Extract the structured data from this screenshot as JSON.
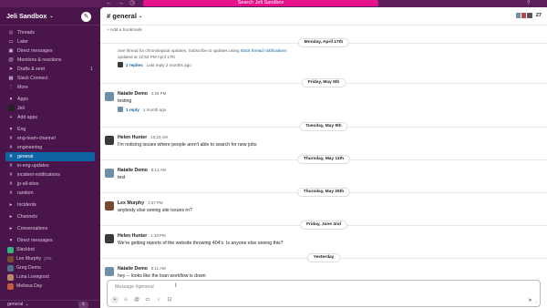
{
  "topbar": {
    "back": "←",
    "forward": "→",
    "history": "◷",
    "search_text": "Search Jeli Sandbox",
    "help": "?"
  },
  "sidebar": {
    "workspace": "Jeli Sandbox",
    "chevron": "⌄",
    "compose_icon": "✎",
    "nav": [
      {
        "icon": "◎",
        "label": "Threads"
      },
      {
        "icon": "▭",
        "label": "Later"
      },
      {
        "icon": "▣",
        "label": "Direct messages"
      },
      {
        "icon": "@",
        "label": "Mentions & reactions"
      },
      {
        "icon": "➤",
        "label": "Drafts & sent",
        "badge": "1"
      },
      {
        "icon": "▦",
        "label": "Slack Connect"
      },
      {
        "icon": "⋮",
        "label": "More"
      }
    ],
    "apps_header": "Apps",
    "apps": [
      {
        "label": "Jeli"
      },
      {
        "icon": "+",
        "label": "Add apps"
      }
    ],
    "eng_header": "Eng",
    "channels": [
      "eng-team-channel",
      "engineering",
      "general",
      "in-eng-updates",
      "incident-notifications",
      "jp-all-sites",
      "random"
    ],
    "collapsed_sections": [
      "Incidents",
      "Channels",
      "Conversations"
    ],
    "dm_header": "Direct messages",
    "dms": [
      {
        "label": "Slackbot",
        "color": "#2eb67d"
      },
      {
        "label": "Lex Murphy",
        "suffix": "you",
        "color": "#7a4a2e"
      },
      {
        "label": "Greg Demo",
        "color": "#4b6f8f"
      },
      {
        "label": "Luna Lovegood",
        "color": "#b98a6a"
      },
      {
        "label": "Melissa Day",
        "color": "#c15a3a"
      }
    ],
    "footer_label": "general",
    "footer_chev": "⌄",
    "footer_badge": "⇩"
  },
  "channel": {
    "name": "# general",
    "chev": "⌄",
    "member_count": "27",
    "bookmark": "+ Add a bookmark"
  },
  "feed": {
    "top_note_text": "See thread for chronological updates. Subscribe to updates using ",
    "top_note_link": "Slack thread notifications",
    "top_note_tail": "updated at 12:53 PM April 17th",
    "top_reply_count": "2 replies",
    "top_reply_last": "Last reply 2 months ago",
    "date_top": "Monday, April 17th",
    "messages": [
      {
        "date": "Friday, May 5th",
        "author": "Natalie Demo",
        "time": "4:26 PM",
        "text": "testing",
        "reply": "1 reply",
        "reply_last": "1 month ago",
        "color": "#6f8fa8"
      },
      {
        "date": "Tuesday, May 9th",
        "author": "Helen Hunter",
        "time": "10:23 AM",
        "text": "I'm noticing issues where people aren't able to search for new jobs",
        "color": "#3a3a3a"
      },
      {
        "date": "Thursday, May 11th",
        "author": "Natalie Demo",
        "time": "8:13 AM",
        "text": "test",
        "color": "#6f8fa8"
      },
      {
        "date": "Thursday, May 25th",
        "author": "Lex Murphy",
        "time": "1:37 PM",
        "text": "anybody else seeing site issues rn?",
        "color": "#7a4a2e"
      },
      {
        "date": "Friday, June 2nd",
        "author": "Helen Hunter",
        "time": "1:33 PM",
        "text": "We're getting reports of the website throwing 404's. Is anyone else seeing this?",
        "color": "#3a3a3a"
      },
      {
        "date": "Yesterday",
        "author": "Natalie Demo",
        "time": "8:11 AM",
        "text": "hey -- looks like the loan workflow is down",
        "color": "#6f8fa8"
      }
    ]
  },
  "composer": {
    "placeholder": "Message #general",
    "tools": [
      "+",
      "☺",
      "@",
      "▭",
      "♪",
      "⊡"
    ],
    "send": "➤",
    "send_opt": "⌄"
  },
  "colors": {
    "sidebar_bg": "#4a154b",
    "search_bg": "#e6118b",
    "active_channel": "#1164a3",
    "link": "#1264a3"
  }
}
